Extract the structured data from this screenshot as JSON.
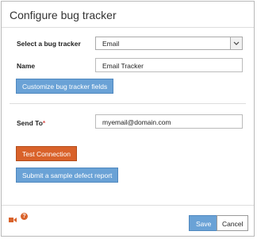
{
  "dialog": {
    "title": "Configure bug tracker"
  },
  "form": {
    "tracker_label": "Select a bug tracker",
    "tracker_value": "Email",
    "name_label": "Name",
    "name_value": "Email Tracker",
    "customize_label": "Customize bug tracker fields",
    "send_to_label": "Send To",
    "required_marker": "*",
    "send_to_value": "myemail@domain.com",
    "test_connection_label": "Test Connection",
    "sample_report_label": "Submit a sample defect report"
  },
  "footer": {
    "video_icon": "video-camera-icon",
    "help_icon": "help-icon",
    "help_glyph": "?",
    "save_label": "Save",
    "cancel_label": "Cancel"
  },
  "colors": {
    "accent_blue": "#6aa2d6",
    "accent_orange": "#d9622a"
  }
}
